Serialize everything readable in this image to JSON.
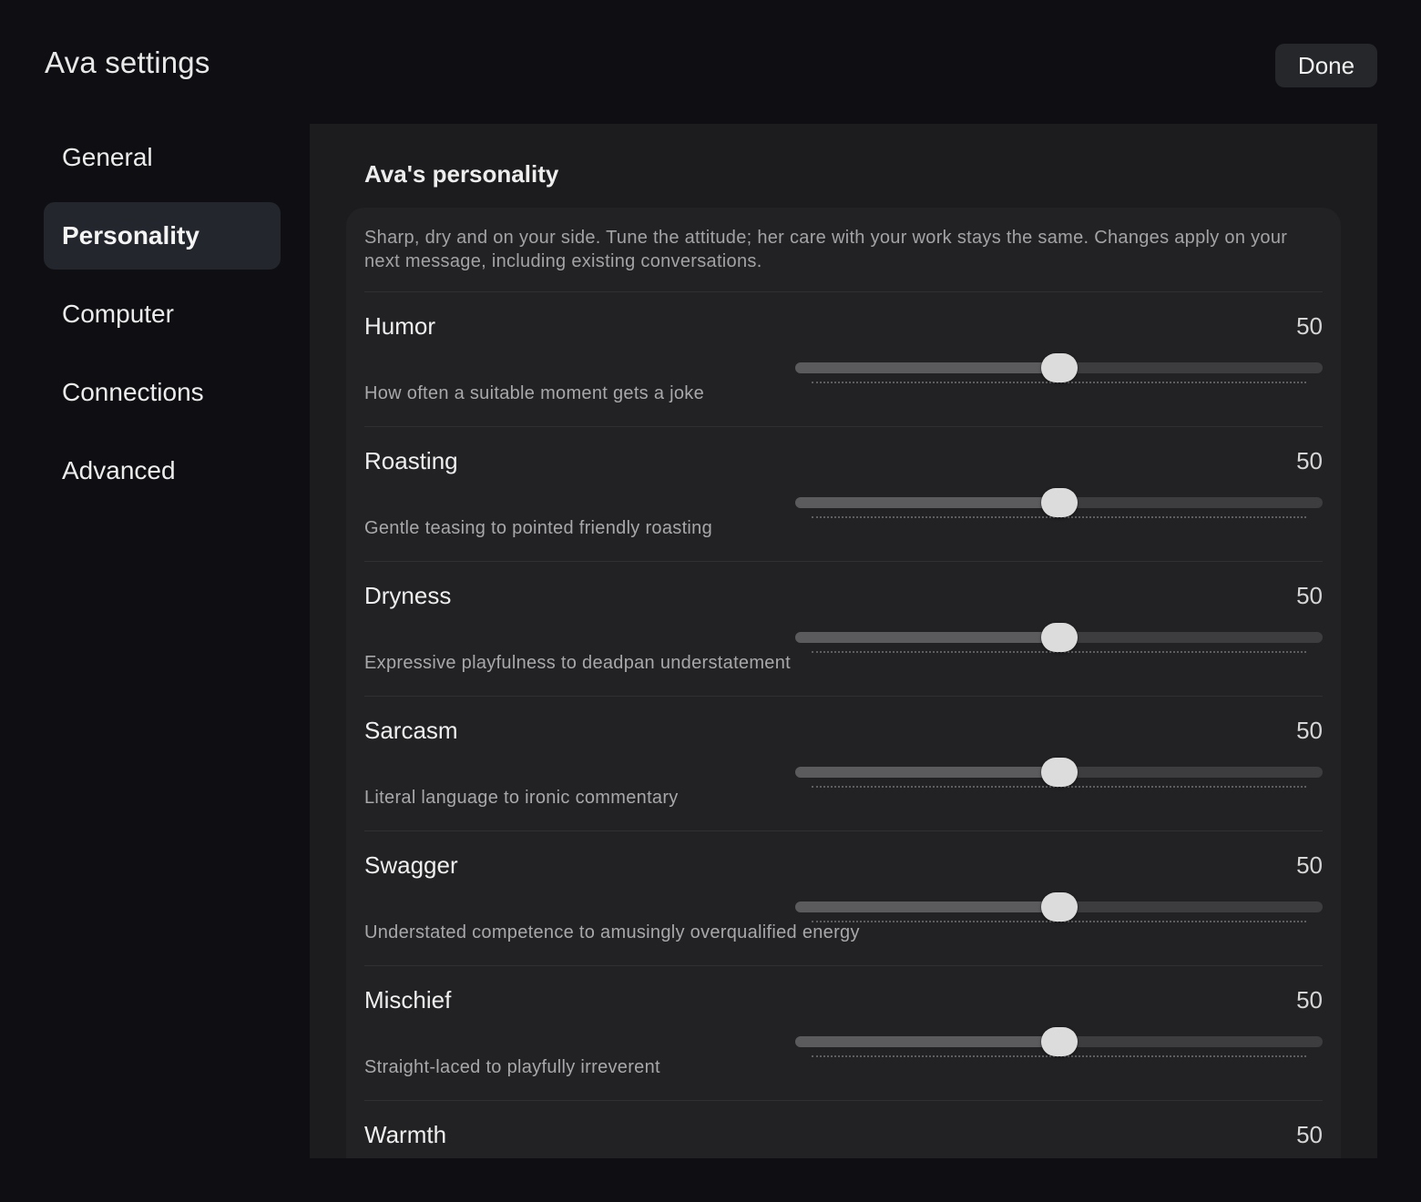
{
  "window": {
    "title": "Ava settings",
    "done_label": "Done"
  },
  "sidebar": {
    "items": [
      {
        "label": "General",
        "active": false
      },
      {
        "label": "Personality",
        "active": true
      },
      {
        "label": "Computer",
        "active": false
      },
      {
        "label": "Connections",
        "active": false
      },
      {
        "label": "Advanced",
        "active": false
      }
    ]
  },
  "personality": {
    "title": "Ava's personality",
    "intro": "Sharp, dry and on your side. Tune the attitude; her care with your work stays the same. Changes apply on your next message, including existing conversations.",
    "traits": [
      {
        "name": "Humor",
        "value": "50",
        "level": 0.5,
        "description": "How often a suitable moment gets a joke"
      },
      {
        "name": "Roasting",
        "value": "50",
        "level": 0.5,
        "description": "Gentle teasing to pointed friendly roasting"
      },
      {
        "name": "Dryness",
        "value": "50",
        "level": 0.5,
        "description": "Expressive playfulness to deadpan understatement"
      },
      {
        "name": "Sarcasm",
        "value": "50",
        "level": 0.5,
        "description": "Literal language to ironic commentary"
      },
      {
        "name": "Swagger",
        "value": "50",
        "level": 0.5,
        "description": "Understated competence to amusingly overqualified energy"
      },
      {
        "name": "Mischief",
        "value": "50",
        "level": 0.5,
        "description": "Straight-laced to playfully irreverent"
      },
      {
        "name": "Warmth",
        "value": "50",
        "level": 0.5,
        "description": ""
      }
    ]
  },
  "colors": {
    "background": "#0f0f13",
    "panel": "#1c1c1e",
    "card": "#222224",
    "active_nav": "#23262d",
    "slider_thumb": "#dcdcdc"
  }
}
